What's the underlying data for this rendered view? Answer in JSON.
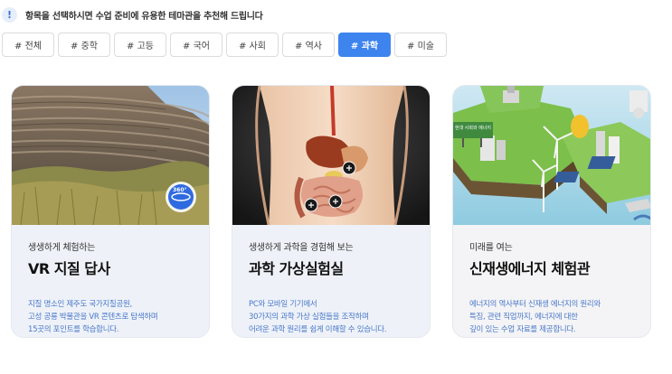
{
  "notice": {
    "icon": "exclamation-icon",
    "text": "항목을 선택하시면 수업 준비에 유용한 테마관을 추천해 드립니다"
  },
  "tabs": [
    {
      "label": "# 전체",
      "active": false
    },
    {
      "label": "# 중학",
      "active": false
    },
    {
      "label": "# 고등",
      "active": false
    },
    {
      "label": "# 국어",
      "active": false
    },
    {
      "label": "# 사회",
      "active": false
    },
    {
      "label": "# 역사",
      "active": false
    },
    {
      "label": "# 과학",
      "active": true
    },
    {
      "label": "# 미술",
      "active": false
    }
  ],
  "accent_color": "#3d84ee",
  "cards": [
    {
      "subtitle": "생생하게 체험하는",
      "title": "VR 지질 답사",
      "description": [
        "지질 명소인 제주도 국가지질공원,",
        "고성 공룡 박물관을 VR 콘텐츠로 탐색하며",
        "15곳의 포인트를 학습합니다."
      ],
      "badge": "360°"
    },
    {
      "subtitle": "생생하게 과학을 경험해 보는",
      "title": "과학 가상실험실",
      "description": [
        "PC와 모바일 기기에서",
        "30가지의 과학 가상 실험들을 조작하며",
        "어려운 과학 원리를 쉽게 이해할 수 있습니다."
      ]
    },
    {
      "subtitle": "미래를 여는",
      "title": "신재생에너지 체험관",
      "description": [
        "에너지의 역사부터 신재생 에너지의 원리와",
        "특징, 관련 직업까지, 에너지에 대한",
        "깊이 있는 수업 자료를 제공합니다."
      ],
      "sign_text": "현대 사회와 에너지"
    }
  ]
}
